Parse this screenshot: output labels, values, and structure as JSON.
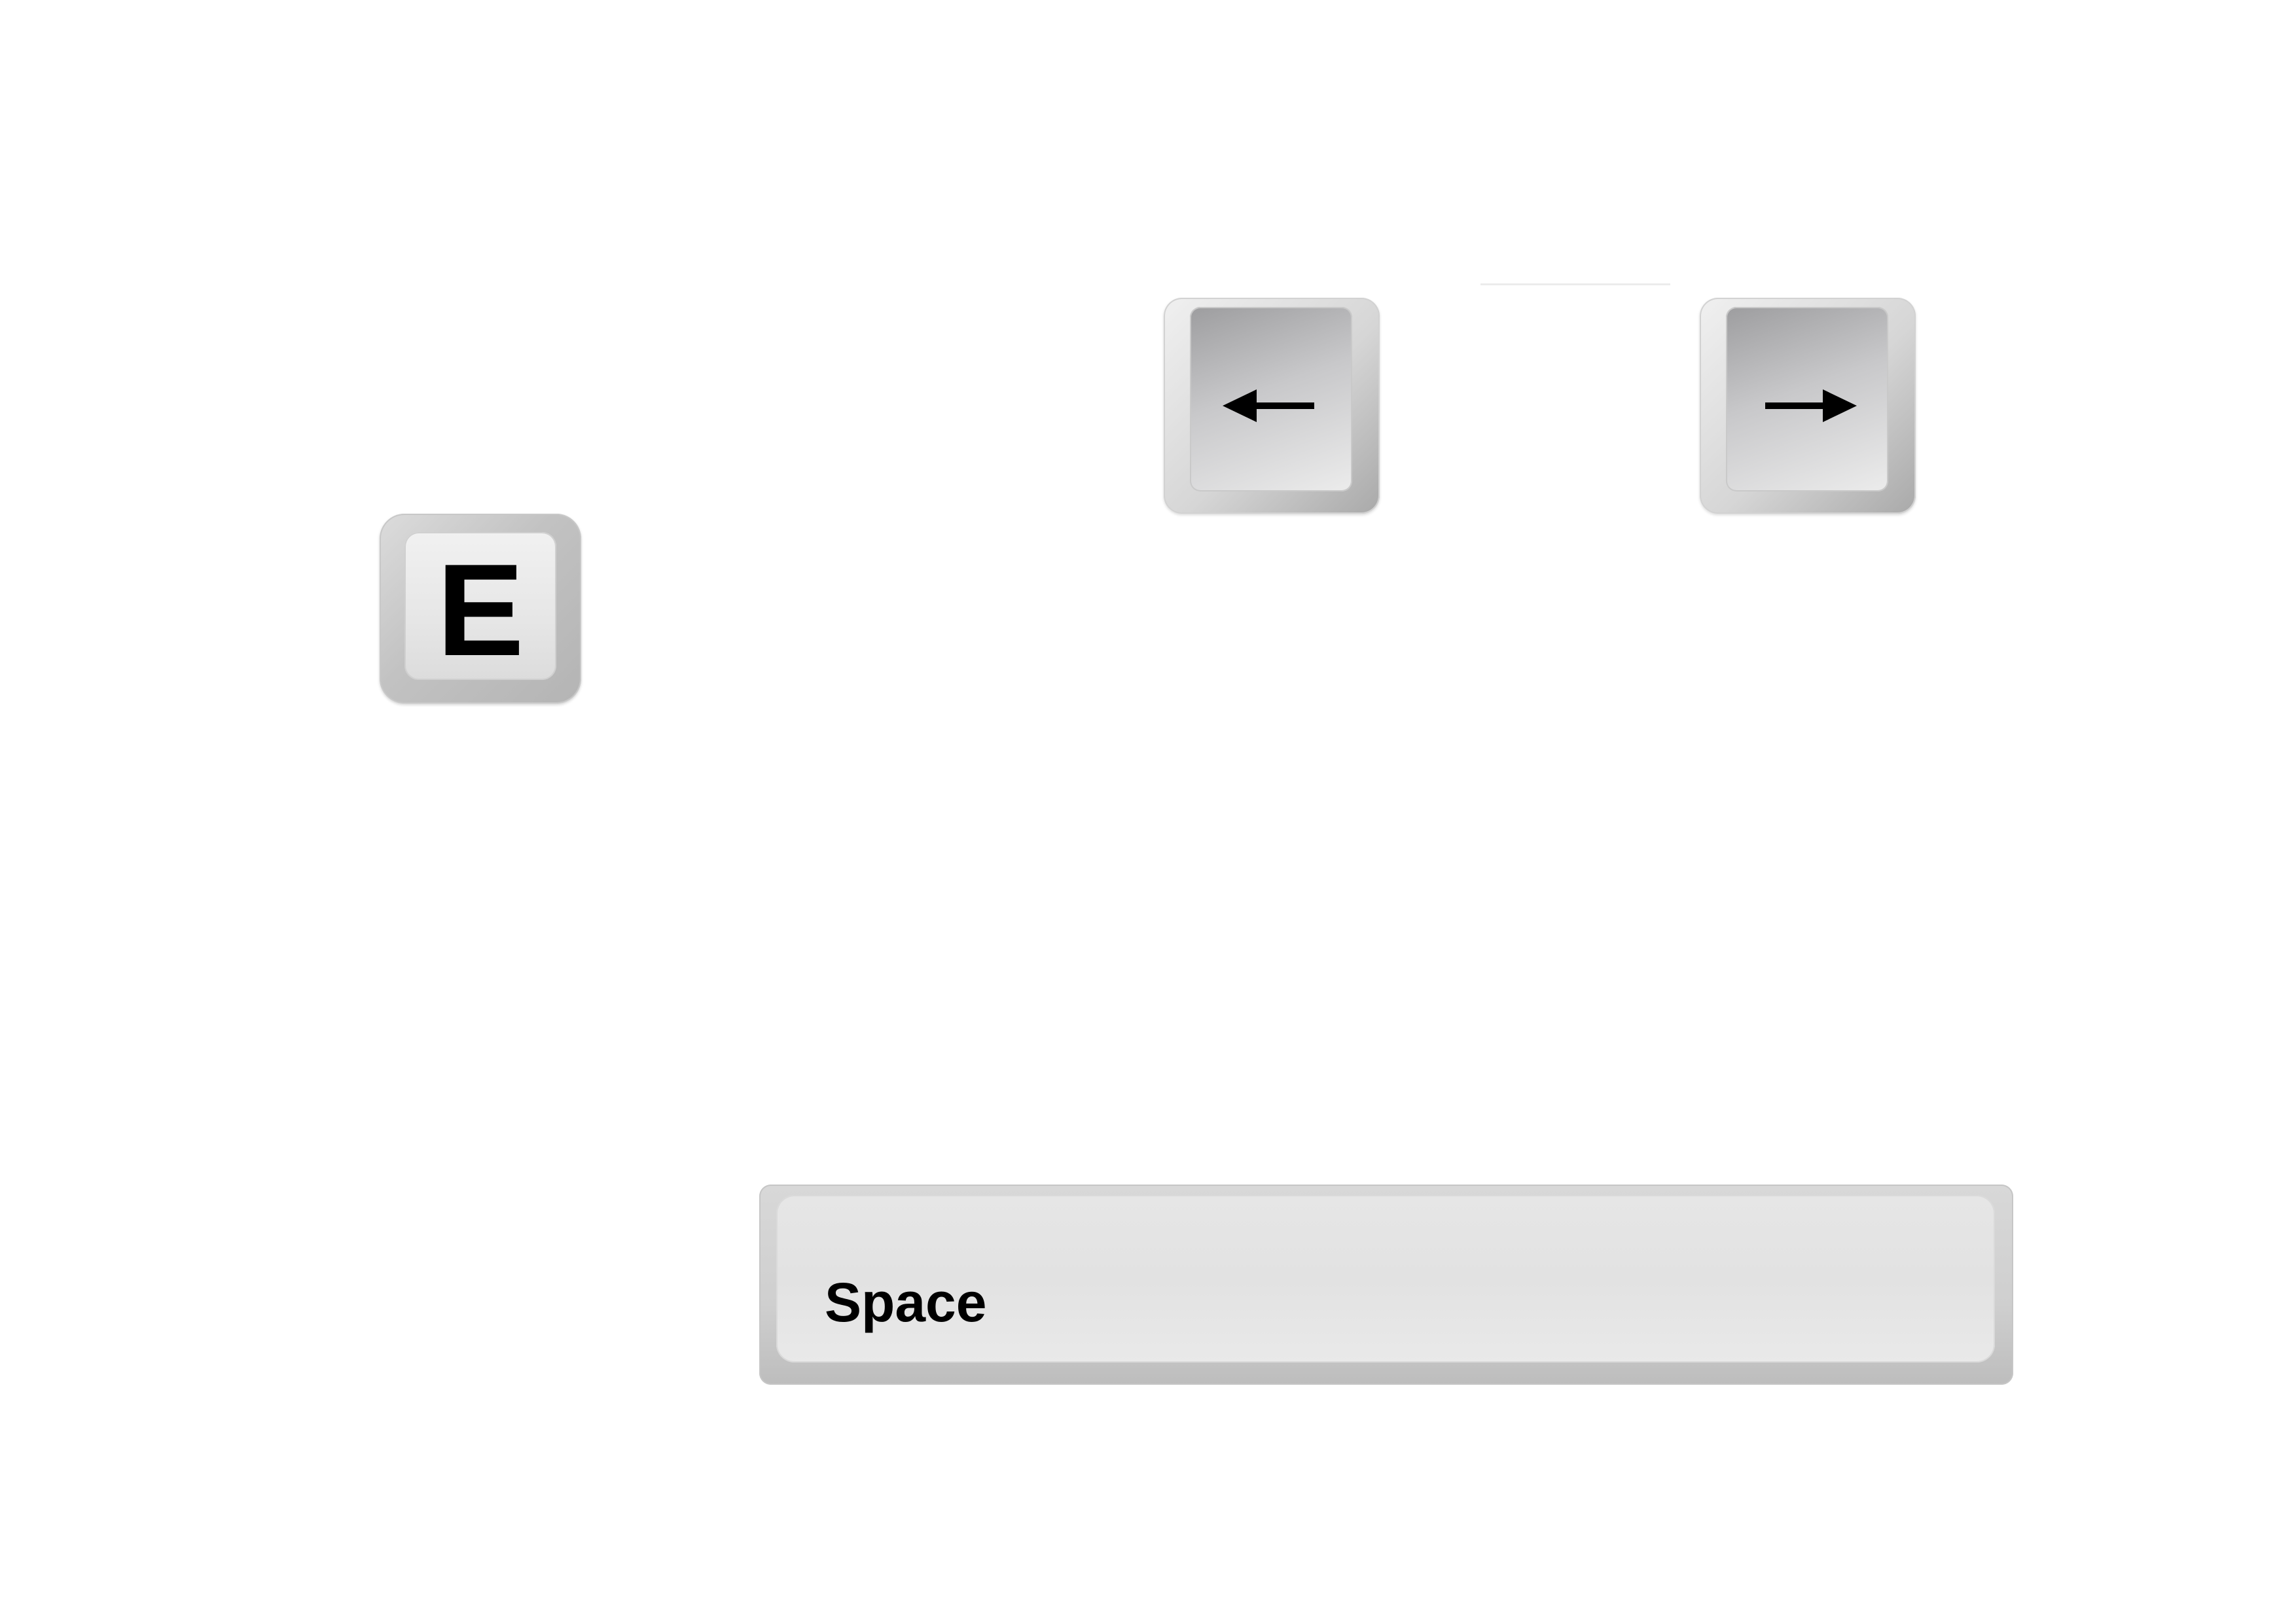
{
  "keys": {
    "e": {
      "label": "E",
      "icon": "letter-e-key"
    },
    "left_arrow": {
      "label": "←",
      "icon": "arrow-left-icon"
    },
    "right_arrow": {
      "label": "→",
      "icon": "arrow-right-icon"
    },
    "space": {
      "label": "Space",
      "icon": "space-bar-key"
    }
  },
  "colors": {
    "background": "#ffffff",
    "key_light": "#e6e6e6",
    "key_dark": "#a9a9a9",
    "glyph": "#000000"
  }
}
